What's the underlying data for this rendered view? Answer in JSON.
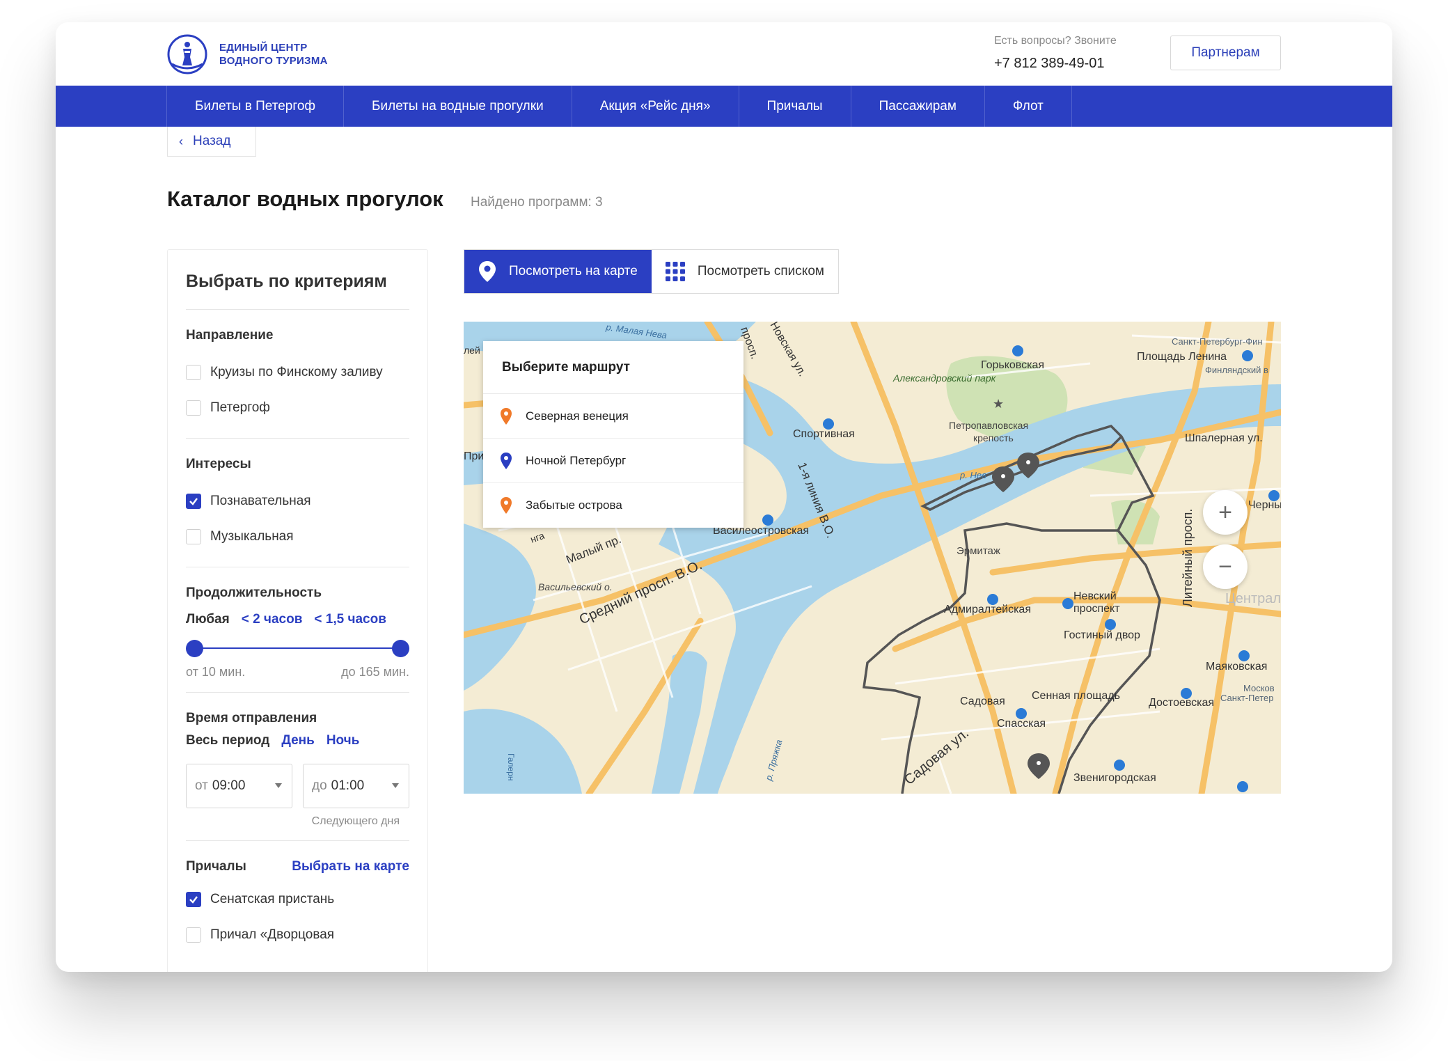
{
  "header": {
    "logo_line1": "ЕДИНЫЙ ЦЕНТР",
    "logo_line2": "ВОДНОГО ТУРИЗМА",
    "contact_question": "Есть вопросы? Звоните",
    "phone": "+7 812 389-49-01",
    "partners_label": "Партнерам"
  },
  "nav": {
    "items": [
      {
        "label": "Билеты в Петергоф"
      },
      {
        "label": "Билеты на водные прогулки"
      },
      {
        "label": "Акция «Рейс дня»"
      },
      {
        "label": "Причалы"
      },
      {
        "label": "Пассажирам"
      },
      {
        "label": "Флот"
      }
    ]
  },
  "back_label": "Назад",
  "page": {
    "title": "Каталог водных прогулок",
    "found": "Найдено программ: 3"
  },
  "filters": {
    "title": "Выбрать по критериям",
    "direction": {
      "heading": "Направление",
      "options": [
        {
          "label": "Круизы по Финскому заливу",
          "checked": false
        },
        {
          "label": "Петергоф",
          "checked": false
        }
      ]
    },
    "interests": {
      "heading": "Интересы",
      "options": [
        {
          "label": "Познавательная",
          "checked": true
        },
        {
          "label": "Музыкальная",
          "checked": false
        }
      ]
    },
    "duration": {
      "heading": "Продолжительность",
      "current": "Любая",
      "quick_1": "< 2 часов",
      "quick_2": "< 1,5 часов",
      "min_label": "от 10 мин.",
      "max_label": "до 165 мин.",
      "range_min_fraction": 0,
      "range_max_fraction": 1
    },
    "departure": {
      "heading": "Время отправления",
      "current": "Весь период",
      "day": "День",
      "night": "Ночь",
      "from_prefix": "от",
      "from_value": "09:00",
      "to_prefix": "до",
      "to_value": "01:00",
      "next_day": "Следующего дня"
    },
    "piers": {
      "heading": "Причалы",
      "map_link": "Выбрать на карте",
      "options": [
        {
          "label": "Сенатская пристань",
          "checked": true
        },
        {
          "label": "Причал «Дворцовая",
          "checked": false
        }
      ]
    }
  },
  "view_toggle": {
    "map_label": "Посмотреть на карте",
    "list_label": "Посмотреть списком"
  },
  "map": {
    "panel_title": "Выберите маршрут",
    "routes": [
      {
        "label": "Северная венеция",
        "color": "#f07a2a"
      },
      {
        "label": "Ночной Петербург",
        "color": "#2b3fc2"
      },
      {
        "label": "Забытые острова",
        "color": "#f07a2a"
      }
    ],
    "labels": {
      "gorkovskaya": "Горьковская",
      "lenin_sq": "Площадь Ленина",
      "finlyandsky": "Финляндский в",
      "spb_fin": "Санкт-Петербург-Фин",
      "alexpark": "Александровский парк",
      "petropavl_1": "Петропавловская",
      "petropavl_2": "крепость",
      "sportivnaya": "Спортивная",
      "shpalernaya": "Шпалерная ул.",
      "chernyshevskaya": "Чернышев",
      "vasileostrovskaya": "Василеостровская",
      "line1": "1-я линия В.О.",
      "maly": "Малый пр.",
      "sredny": "Средний просп. В.О.",
      "vasilievsky": "Васильевский о.",
      "ermitazh": "Эрмитаж",
      "admiralteyskaya": "Адмиралтейская",
      "nevsky_1": "Невский",
      "nevsky_2": "проспект",
      "gostiny": "Гостиный двор",
      "liteyny": "Литейный просп.",
      "mayakovskaya": "Маяковская",
      "sadovaya": "Садовая",
      "sennaya": "Сенная площадь",
      "dostoevskaya": "Достоевская",
      "moskovsky_1": "Москов",
      "moskovsky_2": "Санкт-Петер",
      "spasskaya": "Спасская",
      "sadovaya_ul": "Садовая ул.",
      "zvenigorodskaya": "Звенигородская",
      "pryazhka": "р. Пряжка",
      "river_neva": "р. Нев",
      "malaya_neva": "р. Малая Нева",
      "galerny": "Галерн",
      "novskaya": "Новская ул.",
      "centr": "Централ",
      "pri": "При",
      "ley": "лей",
      "nga": "нга",
      "prosp": "просп."
    },
    "zoom_in": "+",
    "zoom_out": "−"
  }
}
